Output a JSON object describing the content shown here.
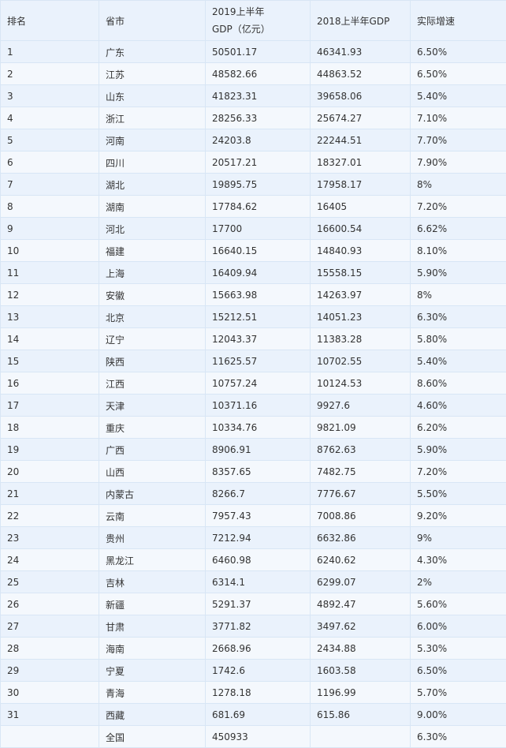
{
  "table": {
    "headers": {
      "rank": "排名",
      "province": "省市",
      "gdp_2019_line1": "2019上半年",
      "gdp_2019_line2": "GDP（亿元）",
      "gdp_2018": "2018上半年GDP",
      "growth": "实际增速"
    },
    "rows": [
      {
        "rank": "1",
        "province": "广东",
        "gdp2019": "50501.17",
        "gdp2018": "46341.93",
        "growth": "6.50%"
      },
      {
        "rank": "2",
        "province": "江苏",
        "gdp2019": "48582.66",
        "gdp2018": "44863.52",
        "growth": "6.50%"
      },
      {
        "rank": "3",
        "province": "山东",
        "gdp2019": "41823.31",
        "gdp2018": "39658.06",
        "growth": "5.40%"
      },
      {
        "rank": "4",
        "province": "浙江",
        "gdp2019": "28256.33",
        "gdp2018": "25674.27",
        "growth": "7.10%"
      },
      {
        "rank": "5",
        "province": "河南",
        "gdp2019": "24203.8",
        "gdp2018": "22244.51",
        "growth": "7.70%"
      },
      {
        "rank": "6",
        "province": "四川",
        "gdp2019": "20517.21",
        "gdp2018": "18327.01",
        "growth": "7.90%"
      },
      {
        "rank": "7",
        "province": "湖北",
        "gdp2019": "19895.75",
        "gdp2018": "17958.17",
        "growth": "8%"
      },
      {
        "rank": "8",
        "province": "湖南",
        "gdp2019": "17784.62",
        "gdp2018": "16405",
        "growth": "7.20%"
      },
      {
        "rank": "9",
        "province": "河北",
        "gdp2019": "17700",
        "gdp2018": "16600.54",
        "growth": "6.62%"
      },
      {
        "rank": "10",
        "province": "福建",
        "gdp2019": "16640.15",
        "gdp2018": "14840.93",
        "growth": "8.10%"
      },
      {
        "rank": "11",
        "province": "上海",
        "gdp2019": "16409.94",
        "gdp2018": "15558.15",
        "growth": "5.90%"
      },
      {
        "rank": "12",
        "province": "安徽",
        "gdp2019": "15663.98",
        "gdp2018": "14263.97",
        "growth": "8%"
      },
      {
        "rank": "13",
        "province": "北京",
        "gdp2019": "15212.51",
        "gdp2018": "14051.23",
        "growth": "6.30%"
      },
      {
        "rank": "14",
        "province": "辽宁",
        "gdp2019": "12043.37",
        "gdp2018": "11383.28",
        "growth": "5.80%"
      },
      {
        "rank": "15",
        "province": "陕西",
        "gdp2019": "11625.57",
        "gdp2018": "10702.55",
        "growth": "5.40%"
      },
      {
        "rank": "16",
        "province": "江西",
        "gdp2019": "10757.24",
        "gdp2018": "10124.53",
        "growth": "8.60%"
      },
      {
        "rank": "17",
        "province": "天津",
        "gdp2019": "10371.16",
        "gdp2018": "9927.6",
        "growth": "4.60%"
      },
      {
        "rank": "18",
        "province": "重庆",
        "gdp2019": "10334.76",
        "gdp2018": "9821.09",
        "growth": "6.20%"
      },
      {
        "rank": "19",
        "province": "广西",
        "gdp2019": "8906.91",
        "gdp2018": "8762.63",
        "growth": "5.90%"
      },
      {
        "rank": "20",
        "province": "山西",
        "gdp2019": "8357.65",
        "gdp2018": "7482.75",
        "growth": "7.20%"
      },
      {
        "rank": "21",
        "province": "内蒙古",
        "gdp2019": "8266.7",
        "gdp2018": "7776.67",
        "growth": "5.50%"
      },
      {
        "rank": "22",
        "province": "云南",
        "gdp2019": "7957.43",
        "gdp2018": "7008.86",
        "growth": "9.20%"
      },
      {
        "rank": "23",
        "province": "贵州",
        "gdp2019": "7212.94",
        "gdp2018": "6632.86",
        "growth": "9%"
      },
      {
        "rank": "24",
        "province": "黑龙江",
        "gdp2019": "6460.98",
        "gdp2018": "6240.62",
        "growth": "4.30%"
      },
      {
        "rank": "25",
        "province": "吉林",
        "gdp2019": "6314.1",
        "gdp2018": "6299.07",
        "growth": "2%"
      },
      {
        "rank": "26",
        "province": "新疆",
        "gdp2019": "5291.37",
        "gdp2018": "4892.47",
        "growth": "5.60%"
      },
      {
        "rank": "27",
        "province": "甘肃",
        "gdp2019": "3771.82",
        "gdp2018": "3497.62",
        "growth": "6.00%"
      },
      {
        "rank": "28",
        "province": "海南",
        "gdp2019": "2668.96",
        "gdp2018": "2434.88",
        "growth": "5.30%"
      },
      {
        "rank": "29",
        "province": "宁夏",
        "gdp2019": "1742.6",
        "gdp2018": "1603.58",
        "growth": "6.50%"
      },
      {
        "rank": "30",
        "province": "青海",
        "gdp2019": "1278.18",
        "gdp2018": "1196.99",
        "growth": "5.70%"
      },
      {
        "rank": "31",
        "province": "西藏",
        "gdp2019": "681.69",
        "gdp2018": "615.86",
        "growth": "9.00%"
      },
      {
        "rank": "",
        "province": "全国",
        "gdp2019": "450933",
        "gdp2018": "",
        "growth": "6.30%"
      }
    ]
  },
  "colors": {
    "border": "#d8e6f5",
    "row_light": "#f4f8fd",
    "row_dark": "#eaf2fc",
    "text": "#333333"
  }
}
